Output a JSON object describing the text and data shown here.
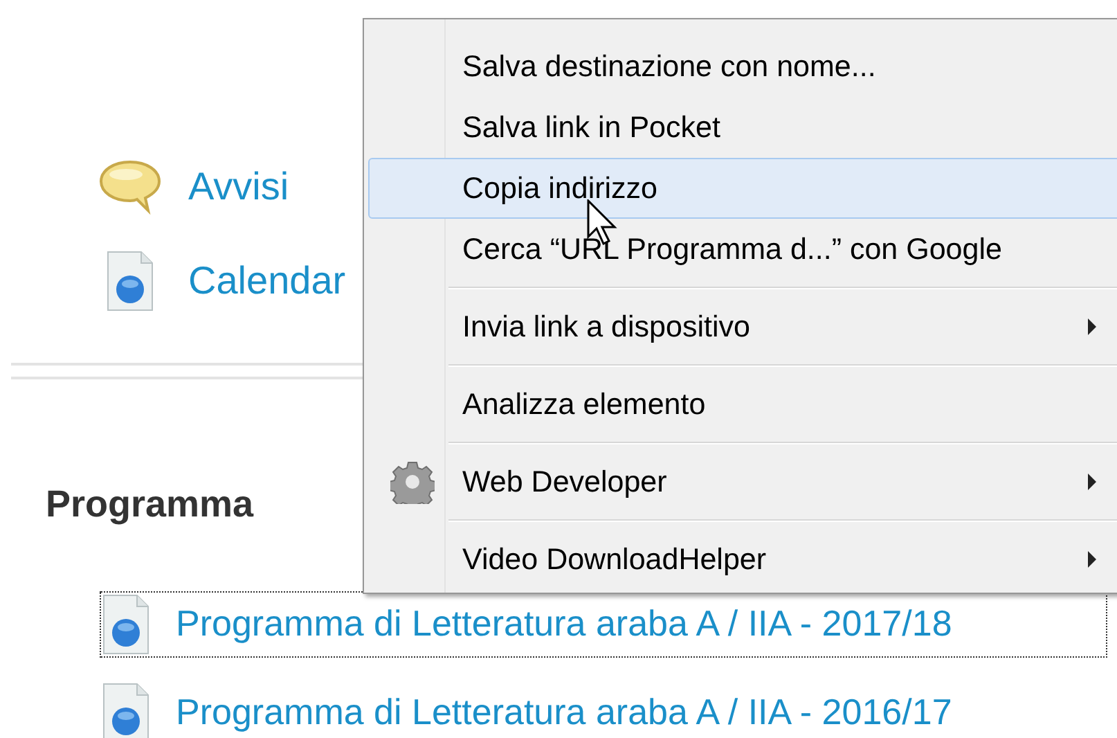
{
  "page": {
    "links_top": [
      {
        "label": "Avvisi",
        "kind": "bubble"
      },
      {
        "label": "Calendar",
        "kind": "doc"
      }
    ],
    "section_title": "Programma",
    "links": [
      {
        "label": "Programma di Letteratura araba A / IIA - 2017/18",
        "focused": true
      },
      {
        "label": "Programma di Letteratura araba A / IIA - 2016/17",
        "focused": false
      }
    ]
  },
  "context_menu": {
    "items": [
      {
        "kind": "item",
        "label": "Salva destinazione con nome...",
        "selected": false,
        "submenu": false,
        "gear_icon": false
      },
      {
        "kind": "item",
        "label": "Salva link in Pocket",
        "selected": false,
        "submenu": false,
        "gear_icon": false
      },
      {
        "kind": "item",
        "label": "Copia indirizzo",
        "selected": true,
        "submenu": false,
        "gear_icon": false
      },
      {
        "kind": "item",
        "label": "Cerca “URL Programma d...” con Google",
        "selected": false,
        "submenu": false,
        "gear_icon": false
      },
      {
        "kind": "separator"
      },
      {
        "kind": "item",
        "label": "Invia link a dispositivo",
        "selected": false,
        "submenu": true,
        "gear_icon": false
      },
      {
        "kind": "separator"
      },
      {
        "kind": "item",
        "label": "Analizza elemento",
        "selected": false,
        "submenu": false,
        "gear_icon": false
      },
      {
        "kind": "separator"
      },
      {
        "kind": "item",
        "label": "Web Developer",
        "selected": false,
        "submenu": true,
        "gear_icon": true
      },
      {
        "kind": "separator"
      },
      {
        "kind": "item",
        "label": "Video DownloadHelper",
        "selected": false,
        "submenu": true,
        "gear_icon": false
      }
    ]
  }
}
